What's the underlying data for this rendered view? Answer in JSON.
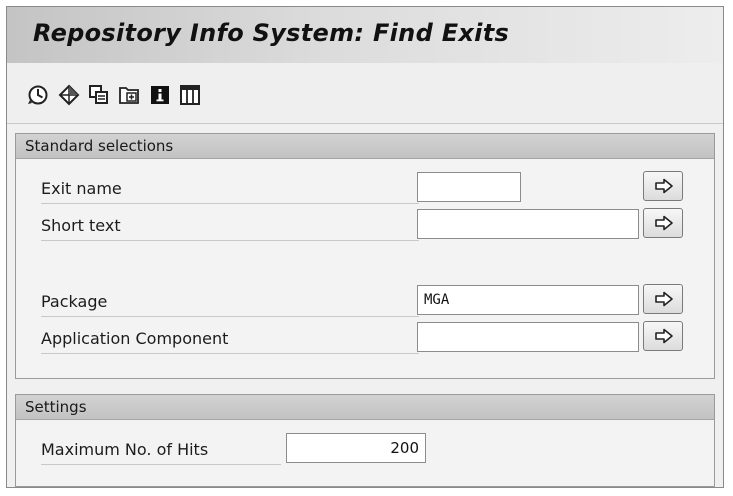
{
  "window": {
    "title": "Repository Info System: Find Exits"
  },
  "toolbar": {
    "icons": [
      "execute-clock-icon",
      "diamond-icon",
      "copy-pages-icon",
      "folder-add-icon",
      "info-icon",
      "table-columns-icon"
    ]
  },
  "standard_selections": {
    "header": "Standard selections",
    "fields": [
      {
        "label": "Exit name",
        "value": ""
      },
      {
        "label": "Short text",
        "value": ""
      },
      {
        "label": "Package",
        "value": "MGA"
      },
      {
        "label": "Application Component",
        "value": ""
      }
    ]
  },
  "settings": {
    "header": "Settings",
    "max_hits_label": "Maximum No. of Hits",
    "max_hits_value": "200"
  }
}
